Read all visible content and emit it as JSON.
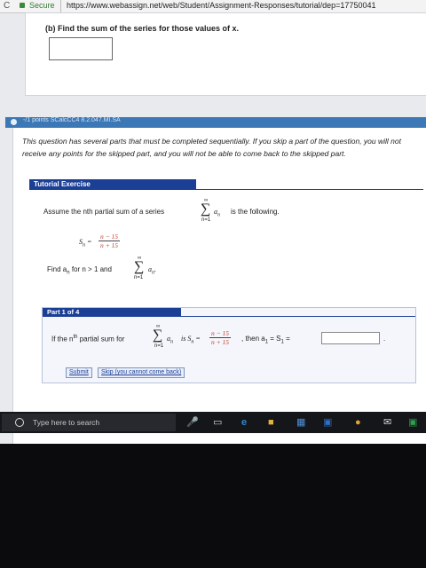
{
  "browser": {
    "secure_label": "Secure",
    "url": "https://www.webassign.net/web/Student/Assignment-Responses/tutorial/dep=17750041"
  },
  "part_b": {
    "question": "(b) Find the sum of the series for those values of x."
  },
  "question": {
    "points_label": "-/1 points  SCalcCC4 8.2.047.MI.SA",
    "intro": "This question has several parts that must be completed sequentially. If you skip a part of the question, you will not receive any points for the skipped part, and you will not be able to come back to the skipped part.",
    "tutorial_title": "Tutorial Exercise",
    "assume_text": "Assume the nth partial sum of a series",
    "series_sym": "∑",
    "series_top": "∞",
    "series_bottom": "n=1",
    "series_term": "a",
    "series_sub": "n",
    "assume_tail": "is the following.",
    "sn_label": "S",
    "sn_sub": "n",
    "equals": "=",
    "frac_top": "n − 15",
    "frac_bottom": "n + 15",
    "find_text": "Find a",
    "find_sub": "n",
    "find_mid": "for n > 1 and",
    "find_sum_term": "a",
    "find_tail": "."
  },
  "part1": {
    "title": "Part 1 of 4",
    "text_a": "If the n",
    "text_sup": "th",
    "text_b": "partial sum for",
    "term": "a",
    "term_sub": "n",
    "is_text": "is S",
    "frac_top": "n − 15",
    "frac_bottom": "n + 15",
    "then_text": ", then a",
    "then_sub": "1",
    "eq_text": "= S",
    "eq_sub": "1",
    "eq_end": "=",
    "answer_value": "",
    "period": ".",
    "submit_label": "Submit",
    "skip_label": "Skip (you cannot come back)"
  },
  "taskbar": {
    "search_placeholder": "Type here to search"
  }
}
